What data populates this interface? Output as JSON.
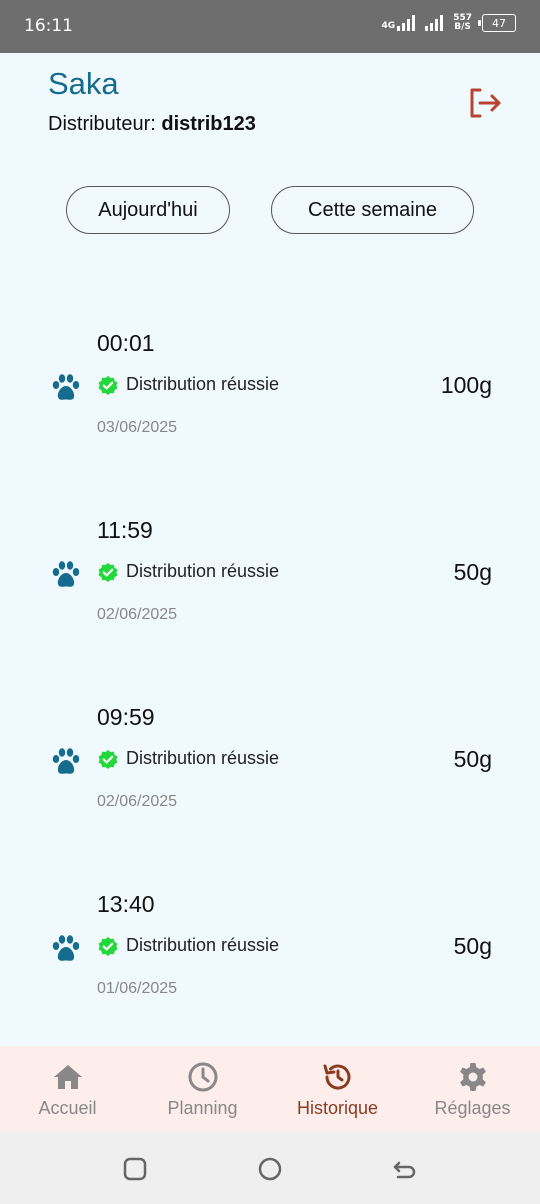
{
  "status_bar": {
    "time": "16:11",
    "network": "4G",
    "speed_value": "557",
    "speed_unit": "B/S",
    "battery": "47"
  },
  "header": {
    "name": "Saka",
    "distributor_label": "Distributeur:",
    "distributor_id": "distrib123",
    "logout_icon": "logout-icon"
  },
  "filters": {
    "today": "Aujourd'hui",
    "week": "Cette semaine"
  },
  "history": [
    {
      "time": "00:01",
      "status": "Distribution réussie",
      "quantity": "100g",
      "date": "03/06/2025"
    },
    {
      "time": "11:59",
      "status": "Distribution réussie",
      "quantity": "50g",
      "date": "02/06/2025"
    },
    {
      "time": "09:59",
      "status": "Distribution réussie",
      "quantity": "50g",
      "date": "02/06/2025"
    },
    {
      "time": "13:40",
      "status": "Distribution réussie",
      "quantity": "50g",
      "date": "01/06/2025"
    }
  ],
  "nav": [
    {
      "label": "Accueil",
      "icon": "home-icon"
    },
    {
      "label": "Planning",
      "icon": "clock-icon"
    },
    {
      "label": "Historique",
      "icon": "history-icon",
      "active": true
    },
    {
      "label": "Réglages",
      "icon": "gear-icon"
    }
  ],
  "colors": {
    "accent": "#156c8e",
    "active_nav": "#8a3c22",
    "success": "#22d83a",
    "logout": "#b8432f"
  }
}
